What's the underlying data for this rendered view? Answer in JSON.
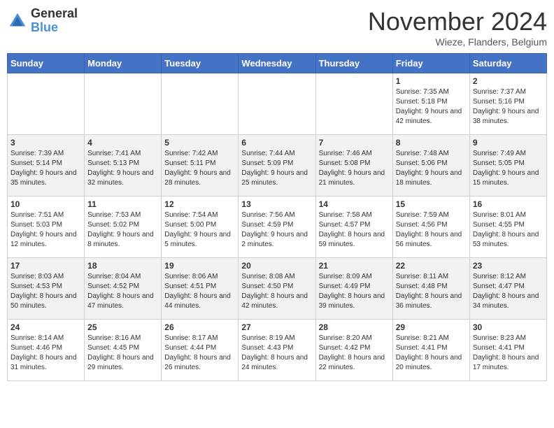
{
  "header": {
    "logo_general": "General",
    "logo_blue": "Blue",
    "month_title": "November 2024",
    "location": "Wieze, Flanders, Belgium"
  },
  "days_of_week": [
    "Sunday",
    "Monday",
    "Tuesday",
    "Wednesday",
    "Thursday",
    "Friday",
    "Saturday"
  ],
  "weeks": [
    [
      {
        "day": "",
        "detail": ""
      },
      {
        "day": "",
        "detail": ""
      },
      {
        "day": "",
        "detail": ""
      },
      {
        "day": "",
        "detail": ""
      },
      {
        "day": "",
        "detail": ""
      },
      {
        "day": "1",
        "detail": "Sunrise: 7:35 AM\nSunset: 5:18 PM\nDaylight: 9 hours and 42 minutes."
      },
      {
        "day": "2",
        "detail": "Sunrise: 7:37 AM\nSunset: 5:16 PM\nDaylight: 9 hours and 38 minutes."
      }
    ],
    [
      {
        "day": "3",
        "detail": "Sunrise: 7:39 AM\nSunset: 5:14 PM\nDaylight: 9 hours and 35 minutes."
      },
      {
        "day": "4",
        "detail": "Sunrise: 7:41 AM\nSunset: 5:13 PM\nDaylight: 9 hours and 32 minutes."
      },
      {
        "day": "5",
        "detail": "Sunrise: 7:42 AM\nSunset: 5:11 PM\nDaylight: 9 hours and 28 minutes."
      },
      {
        "day": "6",
        "detail": "Sunrise: 7:44 AM\nSunset: 5:09 PM\nDaylight: 9 hours and 25 minutes."
      },
      {
        "day": "7",
        "detail": "Sunrise: 7:46 AM\nSunset: 5:08 PM\nDaylight: 9 hours and 21 minutes."
      },
      {
        "day": "8",
        "detail": "Sunrise: 7:48 AM\nSunset: 5:06 PM\nDaylight: 9 hours and 18 minutes."
      },
      {
        "day": "9",
        "detail": "Sunrise: 7:49 AM\nSunset: 5:05 PM\nDaylight: 9 hours and 15 minutes."
      }
    ],
    [
      {
        "day": "10",
        "detail": "Sunrise: 7:51 AM\nSunset: 5:03 PM\nDaylight: 9 hours and 12 minutes."
      },
      {
        "day": "11",
        "detail": "Sunrise: 7:53 AM\nSunset: 5:02 PM\nDaylight: 9 hours and 8 minutes."
      },
      {
        "day": "12",
        "detail": "Sunrise: 7:54 AM\nSunset: 5:00 PM\nDaylight: 9 hours and 5 minutes."
      },
      {
        "day": "13",
        "detail": "Sunrise: 7:56 AM\nSunset: 4:59 PM\nDaylight: 9 hours and 2 minutes."
      },
      {
        "day": "14",
        "detail": "Sunrise: 7:58 AM\nSunset: 4:57 PM\nDaylight: 8 hours and 59 minutes."
      },
      {
        "day": "15",
        "detail": "Sunrise: 7:59 AM\nSunset: 4:56 PM\nDaylight: 8 hours and 56 minutes."
      },
      {
        "day": "16",
        "detail": "Sunrise: 8:01 AM\nSunset: 4:55 PM\nDaylight: 8 hours and 53 minutes."
      }
    ],
    [
      {
        "day": "17",
        "detail": "Sunrise: 8:03 AM\nSunset: 4:53 PM\nDaylight: 8 hours and 50 minutes."
      },
      {
        "day": "18",
        "detail": "Sunrise: 8:04 AM\nSunset: 4:52 PM\nDaylight: 8 hours and 47 minutes."
      },
      {
        "day": "19",
        "detail": "Sunrise: 8:06 AM\nSunset: 4:51 PM\nDaylight: 8 hours and 44 minutes."
      },
      {
        "day": "20",
        "detail": "Sunrise: 8:08 AM\nSunset: 4:50 PM\nDaylight: 8 hours and 42 minutes."
      },
      {
        "day": "21",
        "detail": "Sunrise: 8:09 AM\nSunset: 4:49 PM\nDaylight: 8 hours and 39 minutes."
      },
      {
        "day": "22",
        "detail": "Sunrise: 8:11 AM\nSunset: 4:48 PM\nDaylight: 8 hours and 36 minutes."
      },
      {
        "day": "23",
        "detail": "Sunrise: 8:12 AM\nSunset: 4:47 PM\nDaylight: 8 hours and 34 minutes."
      }
    ],
    [
      {
        "day": "24",
        "detail": "Sunrise: 8:14 AM\nSunset: 4:46 PM\nDaylight: 8 hours and 31 minutes."
      },
      {
        "day": "25",
        "detail": "Sunrise: 8:16 AM\nSunset: 4:45 PM\nDaylight: 8 hours and 29 minutes."
      },
      {
        "day": "26",
        "detail": "Sunrise: 8:17 AM\nSunset: 4:44 PM\nDaylight: 8 hours and 26 minutes."
      },
      {
        "day": "27",
        "detail": "Sunrise: 8:19 AM\nSunset: 4:43 PM\nDaylight: 8 hours and 24 minutes."
      },
      {
        "day": "28",
        "detail": "Sunrise: 8:20 AM\nSunset: 4:42 PM\nDaylight: 8 hours and 22 minutes."
      },
      {
        "day": "29",
        "detail": "Sunrise: 8:21 AM\nSunset: 4:41 PM\nDaylight: 8 hours and 20 minutes."
      },
      {
        "day": "30",
        "detail": "Sunrise: 8:23 AM\nSunset: 4:41 PM\nDaylight: 8 hours and 17 minutes."
      }
    ]
  ]
}
